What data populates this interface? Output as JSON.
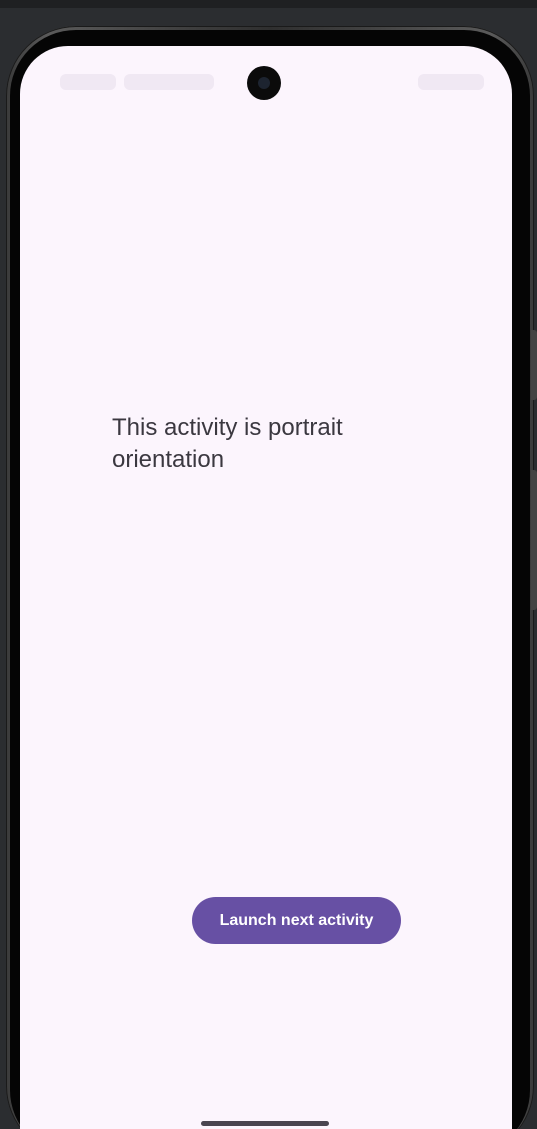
{
  "screen": {
    "message": "This activity is portrait orientation",
    "launch_button_label": "Launch next activity"
  },
  "colors": {
    "background": "#fcf5fd",
    "primary": "#6750a4",
    "on_primary": "#ffffff",
    "text": "#3b3840"
  },
  "icons": {
    "camera": "front-camera-icon",
    "nav": "gesture-nav-handle"
  }
}
